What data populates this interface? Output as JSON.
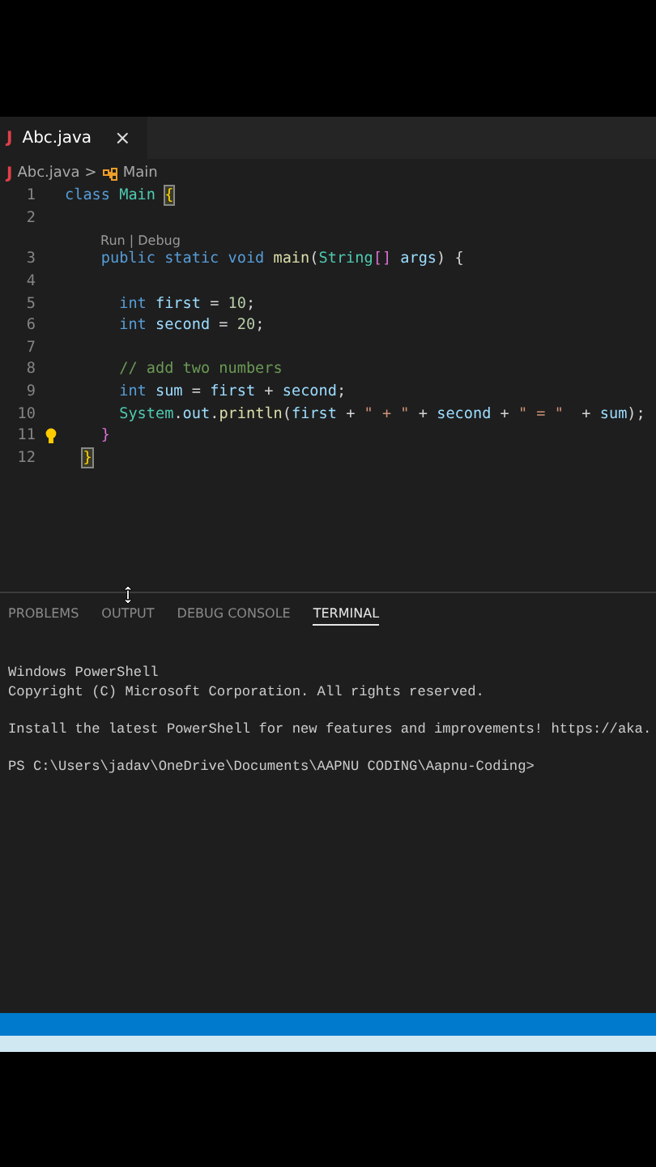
{
  "editor_tabs": [
    {
      "icon": "J",
      "label": "Abc.java",
      "close": "×",
      "selected": true
    }
  ],
  "breadcrumb": {
    "icon": "J",
    "file": "Abc.java",
    "separator": ">",
    "symbol": "Main"
  },
  "code_lines": [
    {
      "number": "1",
      "kind": "top",
      "lightbulb": false,
      "tokens": [
        {
          "kind": "keyword",
          "text": "class"
        },
        {
          "kind": "class",
          "text": " Main"
        },
        {
          "kind": "bracket-match",
          "text": " {"
        }
      ]
    },
    {
      "number": "2",
      "lightbulb": false
    },
    {
      "number": "3",
      "kind": "member",
      "lightbulb": false,
      "codelens": "Run | Debug",
      "tokens": [
        {
          "kind": "keyword",
          "text": "public static void"
        },
        {
          "kind": "function",
          "text": " main"
        },
        {
          "kind": "plain",
          "text": "("
        },
        {
          "kind": "class",
          "text": "String"
        },
        {
          "kind": "bracket",
          "text": "[]"
        },
        {
          "kind": "variable",
          "text": " args"
        },
        {
          "kind": "plain",
          "text": ") {"
        }
      ]
    },
    {
      "number": "4",
      "lightbulb": false
    },
    {
      "number": "5",
      "kind": "statement",
      "lightbulb": false,
      "tokens": [
        {
          "kind": "keyword",
          "text": "int"
        },
        {
          "kind": "variable",
          "text": " first"
        },
        {
          "kind": "plain",
          "text": " = "
        },
        {
          "kind": "number",
          "text": "10"
        },
        {
          "kind": "plain",
          "text": ";"
        }
      ]
    },
    {
      "number": "6",
      "kind": "statement",
      "lightbulb": false,
      "tokens": [
        {
          "kind": "keyword",
          "text": "int"
        },
        {
          "kind": "variable",
          "text": " second"
        },
        {
          "kind": "plain",
          "text": " = "
        },
        {
          "kind": "number",
          "text": "20"
        },
        {
          "kind": "plain",
          "text": ";"
        }
      ]
    },
    {
      "number": "7",
      "lightbulb": false
    },
    {
      "number": "8",
      "kind": "statement",
      "lightbulb": false,
      "tokens": [
        {
          "kind": "comment",
          "text": "// add two numbers"
        }
      ]
    },
    {
      "number": "9",
      "kind": "statement",
      "lightbulb": false,
      "tokens": [
        {
          "kind": "keyword",
          "text": "int"
        },
        {
          "kind": "variable",
          "text": " sum"
        },
        {
          "kind": "plain",
          "text": " = "
        },
        {
          "kind": "variable",
          "text": "first"
        },
        {
          "kind": "plain",
          "text": " + "
        },
        {
          "kind": "variable",
          "text": "second"
        },
        {
          "kind": "plain",
          "text": ";"
        }
      ]
    },
    {
      "number": "10",
      "kind": "statement",
      "lightbulb": false,
      "tokens": [
        {
          "kind": "class",
          "text": "System"
        },
        {
          "kind": "plain",
          "text": "."
        },
        {
          "kind": "variable",
          "text": "out"
        },
        {
          "kind": "plain",
          "text": "."
        },
        {
          "kind": "function",
          "text": "println"
        },
        {
          "kind": "plain",
          "text": "("
        },
        {
          "kind": "variable",
          "text": "first"
        },
        {
          "kind": "plain",
          "text": " + "
        },
        {
          "kind": "string",
          "text": "\" + \""
        },
        {
          "kind": "plain",
          "text": " + "
        },
        {
          "kind": "variable",
          "text": "second"
        },
        {
          "kind": "plain",
          "text": " + "
        },
        {
          "kind": "string",
          "text": "\" = \""
        },
        {
          "kind": "plain",
          "text": "  + "
        },
        {
          "kind": "variable",
          "text": "sum"
        },
        {
          "kind": "plain",
          "text": ");"
        }
      ]
    },
    {
      "number": "11",
      "kind": "member",
      "lightbulb": true,
      "tokens": [
        {
          "kind": "bracket2",
          "text": "}"
        }
      ]
    },
    {
      "number": "12",
      "kind": "closing",
      "lightbulb": false,
      "tokens": [
        {
          "kind": "bracket-match",
          "text": "}"
        }
      ]
    }
  ],
  "panel_tabs": [
    {
      "label": "PROBLEMS",
      "selected": false
    },
    {
      "label": "OUTPUT",
      "selected": false
    },
    {
      "label": "DEBUG CONSOLE",
      "selected": false
    },
    {
      "label": "TERMINAL",
      "selected": true
    }
  ],
  "terminal_lines": [
    "Windows PowerShell",
    "Copyright (C) Microsoft Corporation. All rights reserved.",
    "Install the latest PowerShell for new features and improvements! https://aka.",
    "PS C:\\Users\\jadav\\OneDrive\\Documents\\AAPNU CODING\\Aapnu-Coding>"
  ]
}
